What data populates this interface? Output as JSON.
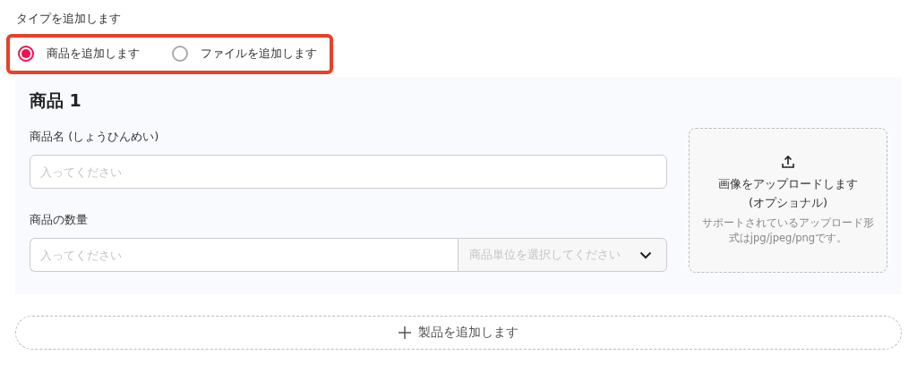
{
  "type_label": "タイプを追加します",
  "type_options": [
    {
      "label": "商品を追加します",
      "selected": true
    },
    {
      "label": "ファイルを追加します",
      "selected": false
    }
  ],
  "product": {
    "title": "商品 1",
    "name_label": "商品名 (しょうひんめい)",
    "name_placeholder": "入ってください",
    "quantity_label": "商品の数量",
    "quantity_placeholder": "入ってください",
    "unit_placeholder": "商品単位を選択してください",
    "upload_title": "画像をアップロードします (オプショナル)",
    "upload_hint": "サポートされているアップロード形式はjpg/jpeg/pngです。"
  },
  "add_button": "製品を追加します"
}
